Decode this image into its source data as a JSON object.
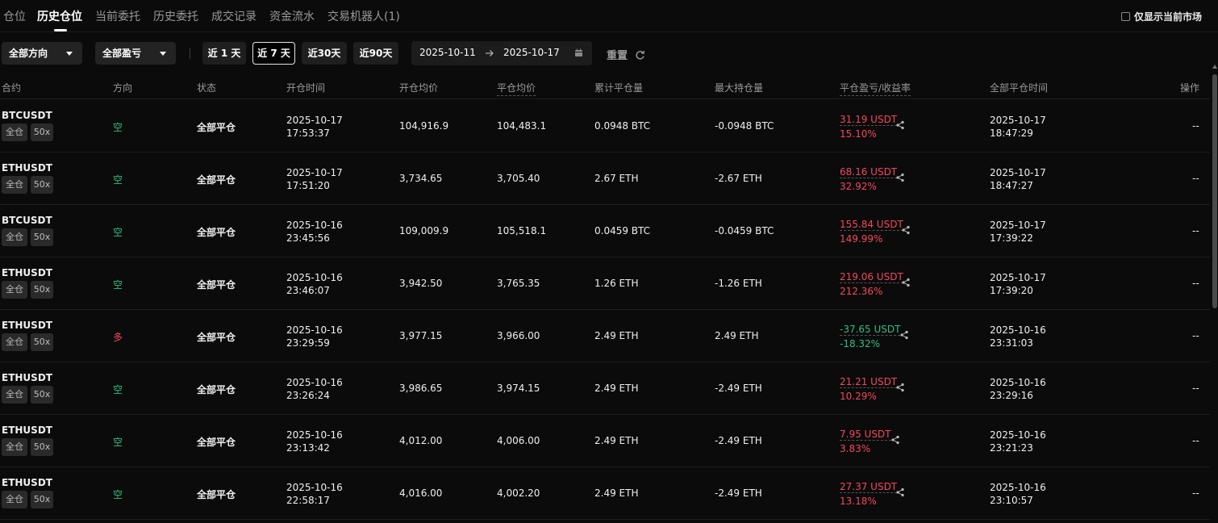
{
  "tabs": [
    "仓位",
    "历史仓位",
    "当前委托",
    "历史委托",
    "成交记录",
    "资金流水",
    "交易机器人(1)"
  ],
  "active_tab": "历史仓位",
  "only_current_market": "仅显示当前市场",
  "filters": {
    "direction": "全部方向",
    "pnl": "全部盈亏",
    "ranges": [
      "近 1 天",
      "近 7 天",
      "近30天",
      "近90天"
    ],
    "active_range": "近 7 天",
    "date_from": "2025-10-11",
    "date_to": "2025-10-17",
    "reset": "重置"
  },
  "columns": {
    "contract": "合约",
    "direction": "方向",
    "status": "状态",
    "open_time": "开仓时间",
    "open_avg": "开仓均价",
    "close_avg": "平仓均价",
    "cum_close_qty": "累计平仓量",
    "max_hold_qty": "最大持仓量",
    "pnl": "平仓盈亏/收益率",
    "close_time": "全部平仓时间",
    "action": "操作"
  },
  "rows": [
    {
      "symbol": "BTCUSDT",
      "margin": "全仓",
      "leverage": "50x",
      "dir": "空",
      "status": "全部平仓",
      "open_date": "2025-10-17",
      "open_clock": "17:53:37",
      "open_avg": "104,916.9",
      "close_avg": "104,483.1",
      "cum": "0.0948 BTC",
      "max": "-0.0948 BTC",
      "pnl": "31.19 USDT",
      "roi": "15.10%",
      "close_date": "2025-10-17",
      "close_clock": "18:47:29",
      "action": "--"
    },
    {
      "symbol": "ETHUSDT",
      "margin": "全仓",
      "leverage": "50x",
      "dir": "空",
      "status": "全部平仓",
      "open_date": "2025-10-17",
      "open_clock": "17:51:20",
      "open_avg": "3,734.65",
      "close_avg": "3,705.40",
      "cum": "2.67 ETH",
      "max": "-2.67 ETH",
      "pnl": "68.16 USDT",
      "roi": "32.92%",
      "close_date": "2025-10-17",
      "close_clock": "18:47:27",
      "action": "--"
    },
    {
      "symbol": "BTCUSDT",
      "margin": "全仓",
      "leverage": "50x",
      "dir": "空",
      "status": "全部平仓",
      "open_date": "2025-10-16",
      "open_clock": "23:45:56",
      "open_avg": "109,009.9",
      "close_avg": "105,518.1",
      "cum": "0.0459 BTC",
      "max": "-0.0459 BTC",
      "pnl": "155.84 USDT",
      "roi": "149.99%",
      "close_date": "2025-10-17",
      "close_clock": "17:39:22",
      "action": "--"
    },
    {
      "symbol": "ETHUSDT",
      "margin": "全仓",
      "leverage": "50x",
      "dir": "空",
      "status": "全部平仓",
      "open_date": "2025-10-16",
      "open_clock": "23:46:07",
      "open_avg": "3,942.50",
      "close_avg": "3,765.35",
      "cum": "1.26 ETH",
      "max": "-1.26 ETH",
      "pnl": "219.06 USDT",
      "roi": "212.36%",
      "close_date": "2025-10-17",
      "close_clock": "17:39:20",
      "action": "--"
    },
    {
      "symbol": "ETHUSDT",
      "margin": "全仓",
      "leverage": "50x",
      "dir": "多",
      "status": "全部平仓",
      "open_date": "2025-10-16",
      "open_clock": "23:29:59",
      "open_avg": "3,977.15",
      "close_avg": "3,966.00",
      "cum": "2.49 ETH",
      "max": "2.49 ETH",
      "pnl": "-37.65 USDT",
      "roi": "-18.32%",
      "close_date": "2025-10-16",
      "close_clock": "23:31:03",
      "action": "--"
    },
    {
      "symbol": "ETHUSDT",
      "margin": "全仓",
      "leverage": "50x",
      "dir": "空",
      "status": "全部平仓",
      "open_date": "2025-10-16",
      "open_clock": "23:26:24",
      "open_avg": "3,986.65",
      "close_avg": "3,974.15",
      "cum": "2.49 ETH",
      "max": "-2.49 ETH",
      "pnl": "21.21 USDT",
      "roi": "10.29%",
      "close_date": "2025-10-16",
      "close_clock": "23:29:16",
      "action": "--"
    },
    {
      "symbol": "ETHUSDT",
      "margin": "全仓",
      "leverage": "50x",
      "dir": "空",
      "status": "全部平仓",
      "open_date": "2025-10-16",
      "open_clock": "23:13:42",
      "open_avg": "4,012.00",
      "close_avg": "4,006.00",
      "cum": "2.49 ETH",
      "max": "-2.49 ETH",
      "pnl": "7.95 USDT",
      "roi": "3.83%",
      "close_date": "2025-10-16",
      "close_clock": "23:21:23",
      "action": "--"
    },
    {
      "symbol": "ETHUSDT",
      "margin": "全仓",
      "leverage": "50x",
      "dir": "空",
      "status": "全部平仓",
      "open_date": "2025-10-16",
      "open_clock": "22:58:17",
      "open_avg": "4,016.00",
      "close_avg": "4,002.20",
      "cum": "2.49 ETH",
      "max": "-2.49 ETH",
      "pnl": "27.37 USDT",
      "roi": "13.18%",
      "close_date": "2025-10-16",
      "close_clock": "23:10:57",
      "action": "--"
    }
  ],
  "colors": {
    "short": "#2ebd85",
    "long": "#f6465d",
    "profit": "#f6465d",
    "loss": "#2ebd85"
  }
}
